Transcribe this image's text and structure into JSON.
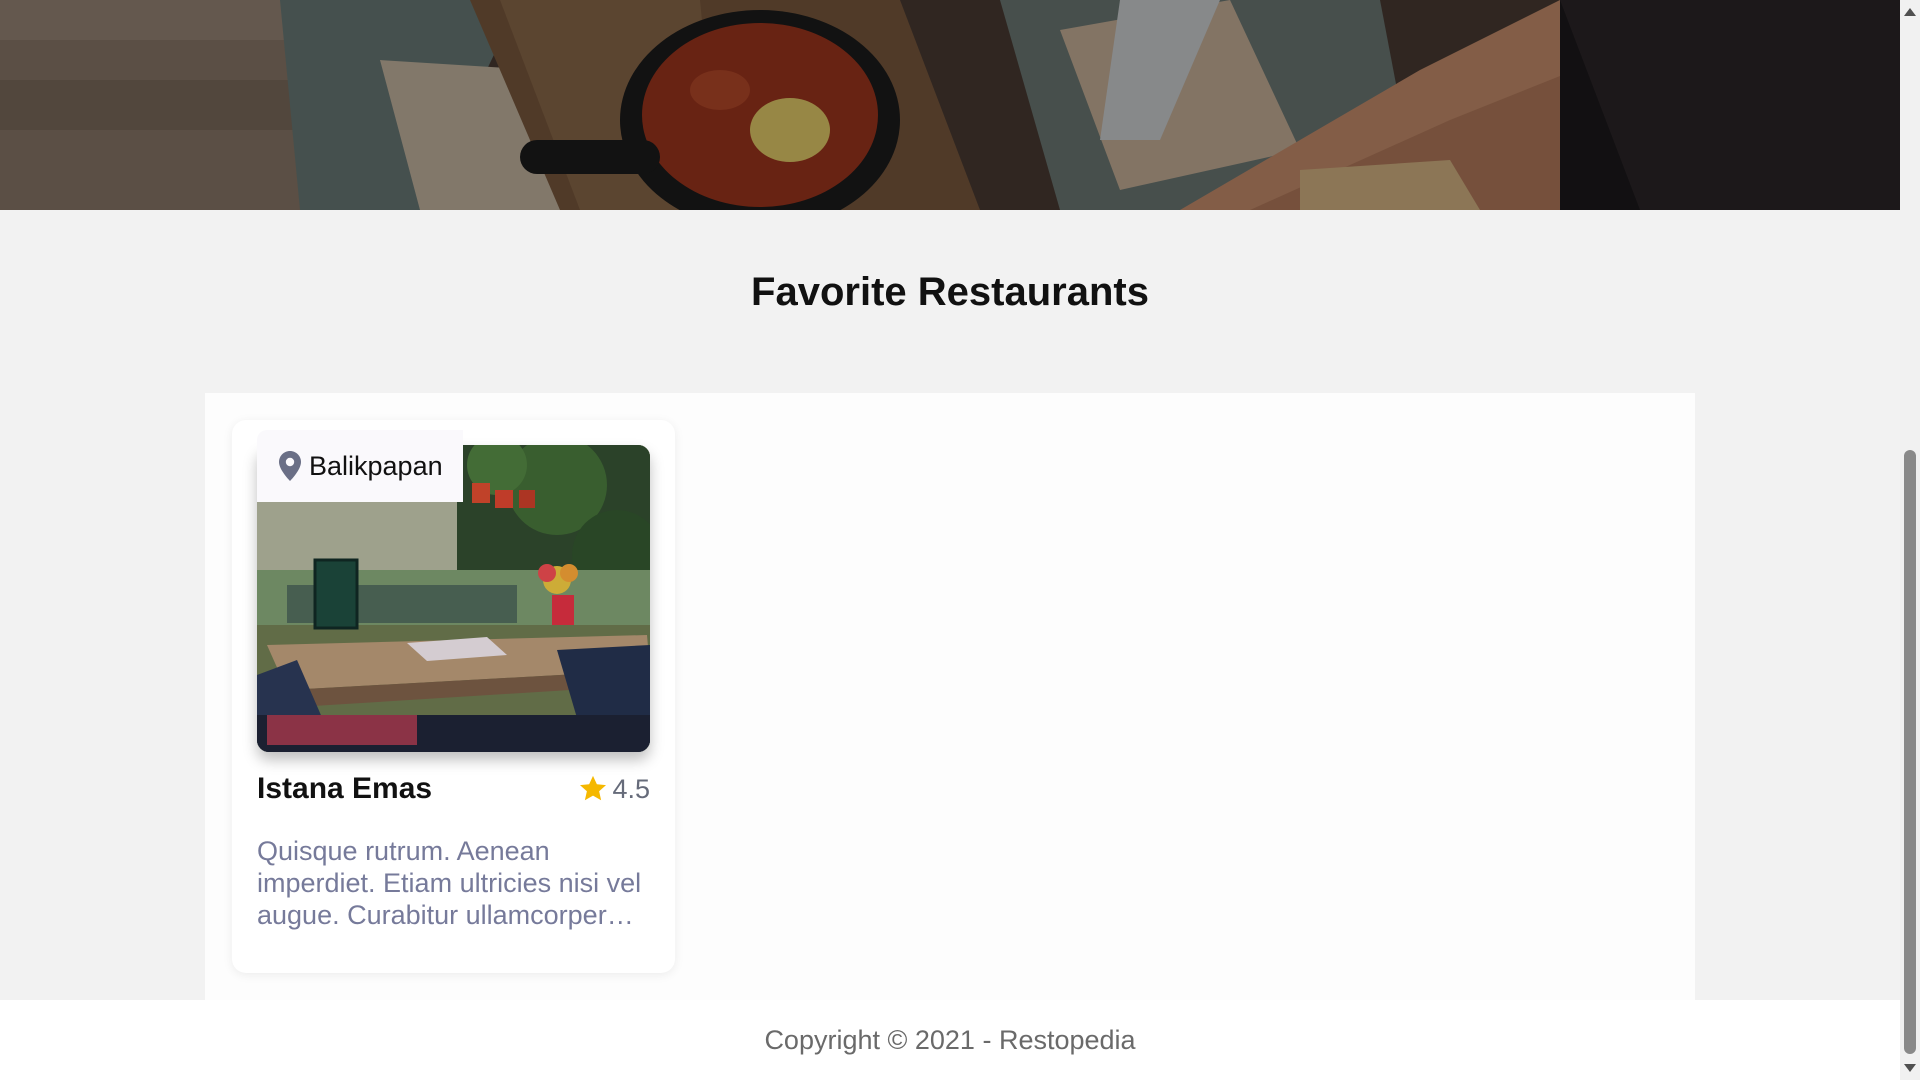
{
  "hero": {
    "icon": "hero-food-photo"
  },
  "section": {
    "title": "Favorite Restaurants"
  },
  "restaurants": [
    {
      "city": "Balikpapan",
      "name": "Istana Emas",
      "rating": "4.5",
      "description": "Quisque rutrum. Aenean imperdiet. Etiam ultricies nisi vel augue. Curabitur ullamcorper ultricies nisi.",
      "colors": {
        "star": "#f5b800",
        "pin": "#6a6f86"
      }
    }
  ],
  "footer": {
    "text": "Copyright © 2021 - Restopedia"
  }
}
